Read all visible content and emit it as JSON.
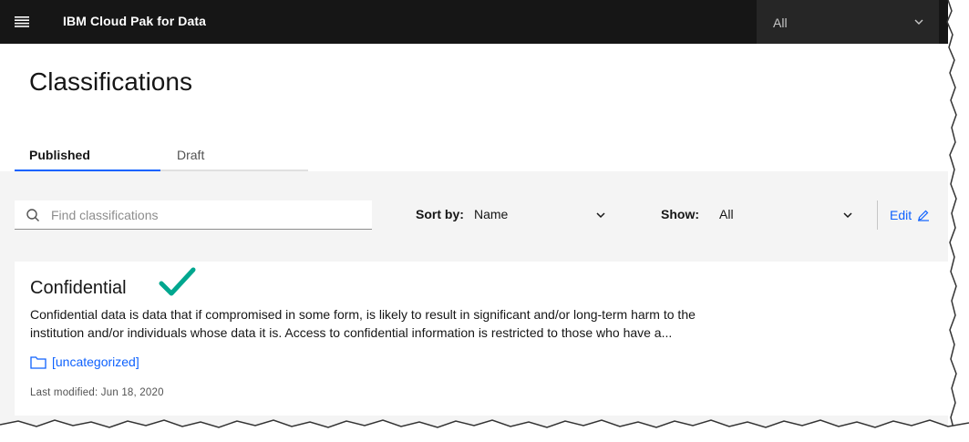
{
  "header": {
    "brand": "IBM Cloud Pak for Data",
    "menu_icon": "hamburger-menu-icon",
    "context_select": {
      "value": "All",
      "icon": "chevron-down-icon"
    }
  },
  "page": {
    "title": "Classifications"
  },
  "tabs": [
    {
      "label": "Published",
      "selected": true
    },
    {
      "label": "Draft",
      "selected": false
    }
  ],
  "toolbar": {
    "search_placeholder": "Find classifications",
    "search_value": "",
    "sort_label": "Sort by:",
    "sort_value": "Name",
    "show_label": "Show:",
    "show_value": "All",
    "edit_label": "Edit"
  },
  "cards": [
    {
      "title": "Confidential",
      "description": "Confidential data is data that if compromised in some form, is likely to result in significant and/or long-term harm to the institution and/or individuals whose data it is. Access to confidential information is restricted to those who have a...",
      "category": "[uncategorized]",
      "modified": "Last modified: Jun 18, 2020"
    }
  ],
  "colors": {
    "header_bg": "#161616",
    "accent": "#0f62fe",
    "check": "#00a78f",
    "surface": "#f4f4f4"
  }
}
